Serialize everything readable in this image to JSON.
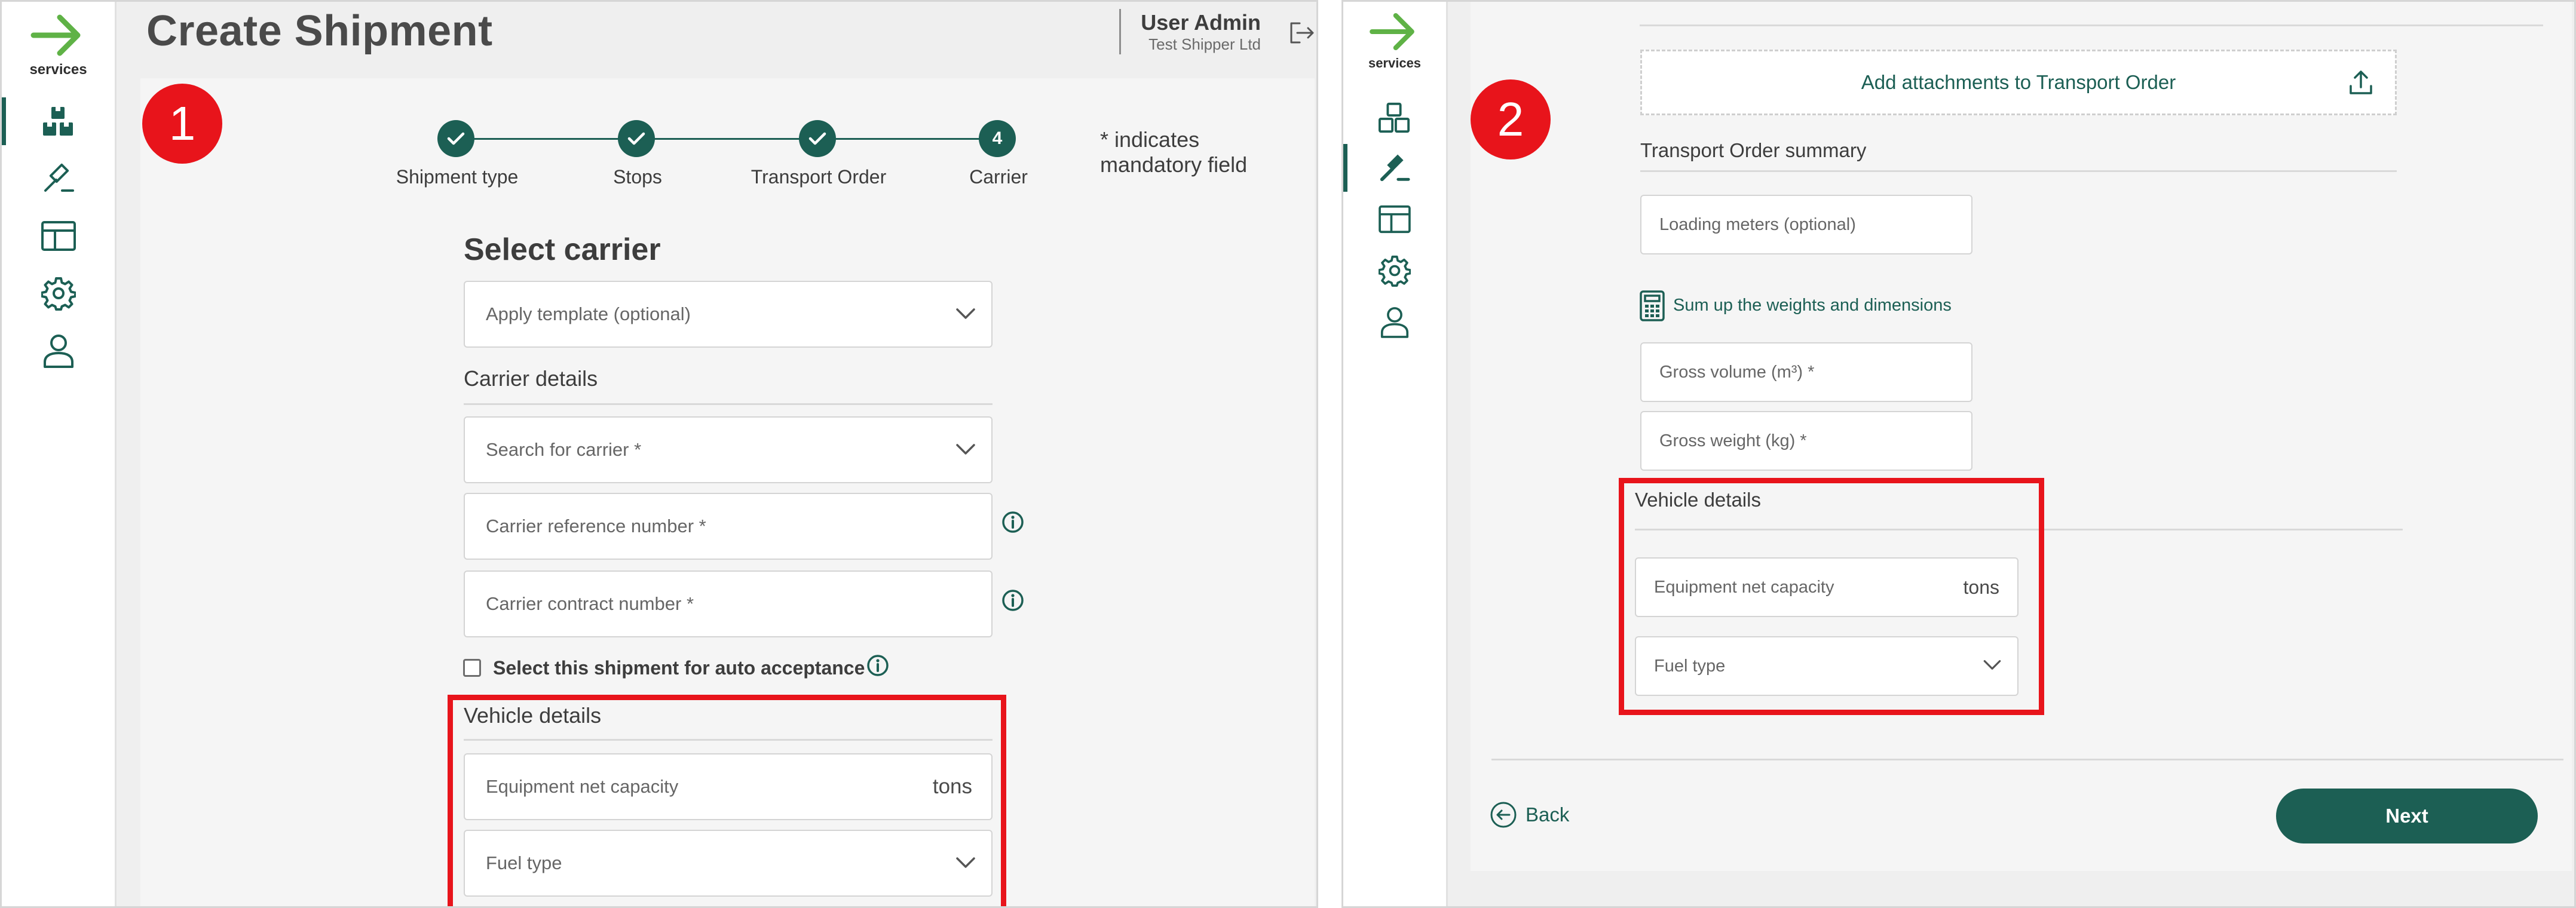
{
  "colors": {
    "brand_green": "#1c5f54",
    "logo_green": "#5fb246",
    "highlight_red": "#e8141b",
    "background": "#efefef"
  },
  "logo": {
    "text": "services"
  },
  "sidebar_icons": [
    "shipments-boxes-icon",
    "auction-hammer-icon",
    "layout-table-icon",
    "settings-gear-icon",
    "user-profile-icon"
  ],
  "panel1": {
    "badge": "1",
    "title": "Create Shipment",
    "user": {
      "name": "User Admin",
      "company": "Test Shipper Ltd"
    },
    "stepper": {
      "steps": [
        {
          "label": "Shipment type",
          "state": "done"
        },
        {
          "label": "Stops",
          "state": "done"
        },
        {
          "label": "Transport Order",
          "state": "done"
        },
        {
          "label": "Carrier",
          "state": "current",
          "number": "4"
        }
      ],
      "mandatory_note": "* indicates mandatory field"
    },
    "form": {
      "heading": "Select carrier",
      "apply_template": "Apply template (optional)",
      "carrier_details_label": "Carrier details",
      "search_carrier": "Search for carrier *",
      "carrier_reference": "Carrier reference number *",
      "carrier_contract": "Carrier contract number *",
      "auto_acceptance_label": "Select this shipment for auto acceptance",
      "vehicle_details_label": "Vehicle details",
      "equipment_capacity": "Equipment net capacity",
      "capacity_unit": "tons",
      "fuel_type": "Fuel type"
    }
  },
  "panel2": {
    "badge": "2",
    "attachments_button": "Add attachments to Transport Order",
    "summary_label": "Transport Order summary",
    "loading_meters": "Loading meters (optional)",
    "sum_up_link": "Sum up the weights and dimensions",
    "gross_volume": "Gross volume (m³) *",
    "gross_weight": "Gross weight (kg) *",
    "vehicle_details_label": "Vehicle details",
    "equipment_capacity": "Equipment net capacity",
    "capacity_unit": "tons",
    "fuel_type": "Fuel type",
    "back_label": "Back",
    "next_label": "Next"
  }
}
